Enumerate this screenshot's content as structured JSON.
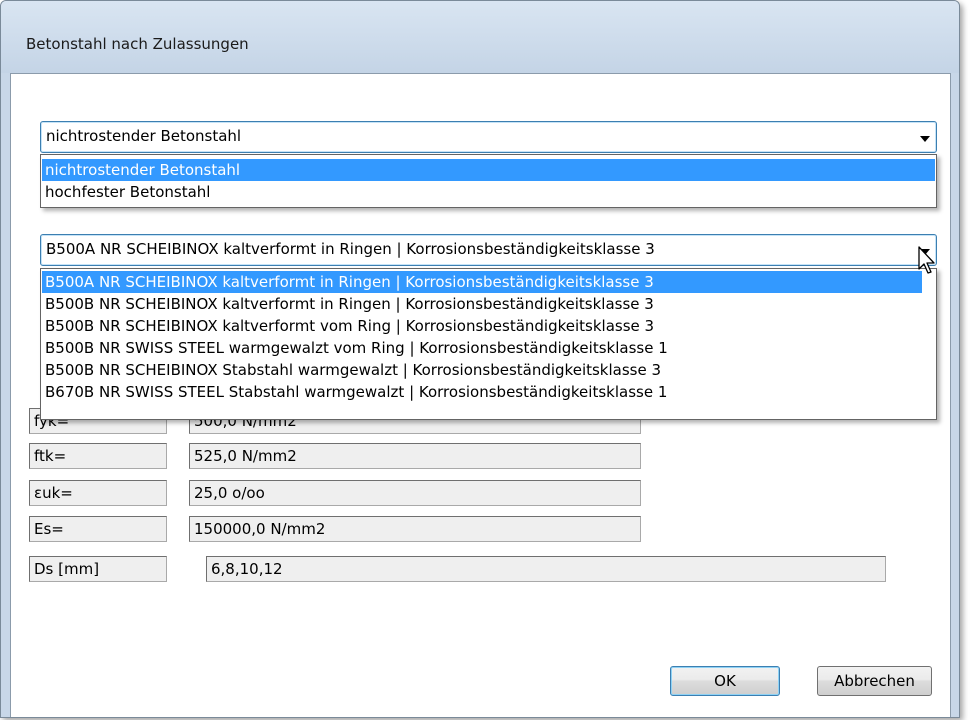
{
  "window": {
    "title": "Betonstahl nach Zulassungen"
  },
  "category_dropdown": {
    "selected": "nichtrostender Betonstahl",
    "options": [
      "nichtrostender Betonstahl",
      "hochfester Betonstahl"
    ]
  },
  "product_dropdown": {
    "selected": "B500A NR SCHEIBINOX kaltverformt in Ringen | Korrosionsbeständigkeitsklasse 3",
    "options": [
      "B500A NR SCHEIBINOX kaltverformt in Ringen | Korrosionsbeständigkeitsklasse 3",
      "B500B NR SCHEIBINOX kaltverformt in Ringen | Korrosionsbeständigkeitsklasse 3",
      "B500B NR SCHEIBINOX kaltverformt vom Ring | Korrosionsbeständigkeitsklasse 3",
      "B500B NR SWISS STEEL warmgewalzt vom Ring | Korrosionsbeständigkeitsklasse 1",
      "B500B NR SCHEIBINOX Stabstahl warmgewalzt | Korrosionsbeständigkeitsklasse 3",
      "B670B NR SWISS STEEL Stabstahl warmgewalzt | Korrosionsbeständigkeitsklasse 1"
    ]
  },
  "properties": [
    {
      "label": "fyk=",
      "value": "500,0 N/mm2"
    },
    {
      "label": "ftk=",
      "value": "525,0 N/mm2"
    },
    {
      "label": "εuk=",
      "value": "25,0 o/oo"
    },
    {
      "label": "Es=",
      "value": "150000,0 N/mm2"
    },
    {
      "label": "Ds [mm]",
      "value": "6,8,10,12"
    }
  ],
  "buttons": {
    "ok": "OK",
    "cancel": "Abbrechen"
  },
  "colors": {
    "selection": "#3399ff",
    "focus_border": "#3c7fb1",
    "titlebar": "#c8d7e8"
  }
}
